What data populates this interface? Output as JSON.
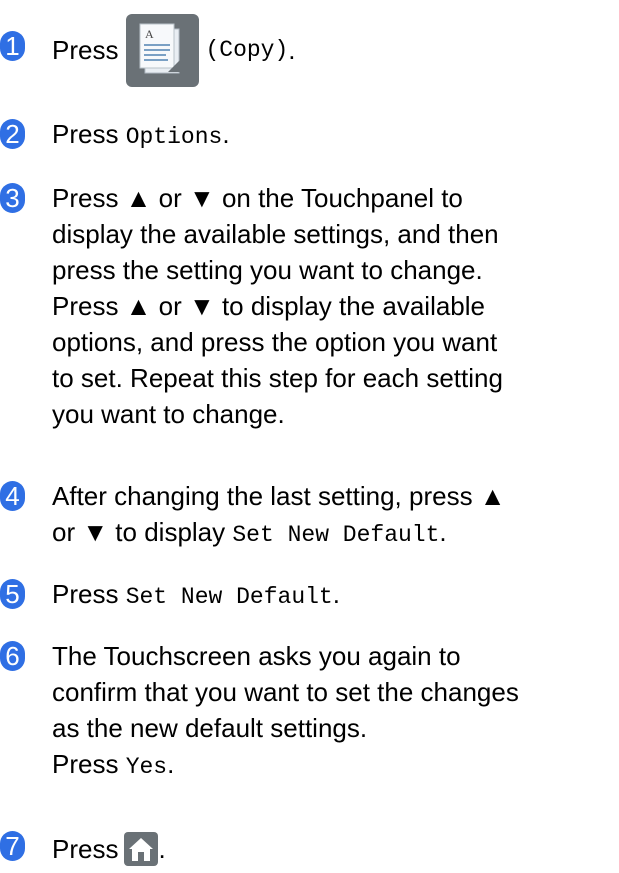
{
  "steps": [
    {
      "num": "1",
      "press": "Press",
      "button_label": "(Copy)",
      "icon": "copy-icon",
      "end": "."
    },
    {
      "num": "2",
      "press": "Press",
      "option": "Options",
      "end": "."
    },
    {
      "num": "3",
      "lines": [
        "Press ▲ or ▼ on the Touchpanel to",
        "display the available settings, and then",
        "press the setting you want to change.",
        "Press ▲ or ▼ to display the available",
        "options, and press the option you want",
        "to set. Repeat this step for each setting",
        "you want to change."
      ]
    },
    {
      "num": "4",
      "line1": "After changing the last setting, press ▲",
      "line2_text": "or ▼ to display",
      "line2_option": "Set New Default",
      "end": "."
    },
    {
      "num": "5",
      "press": "Press",
      "option": "Set New Default",
      "end": "."
    },
    {
      "num": "6",
      "lines": [
        "The Touchscreen asks you again to",
        "confirm that you want to set the changes",
        "as the new default settings."
      ],
      "press": "Press",
      "option": "Yes",
      "end": "."
    },
    {
      "num": "7",
      "press": "Press",
      "icon": "home-icon",
      "end": "."
    }
  ],
  "colors": {
    "badge": "#2f6fe4",
    "button": "#6a7176"
  }
}
